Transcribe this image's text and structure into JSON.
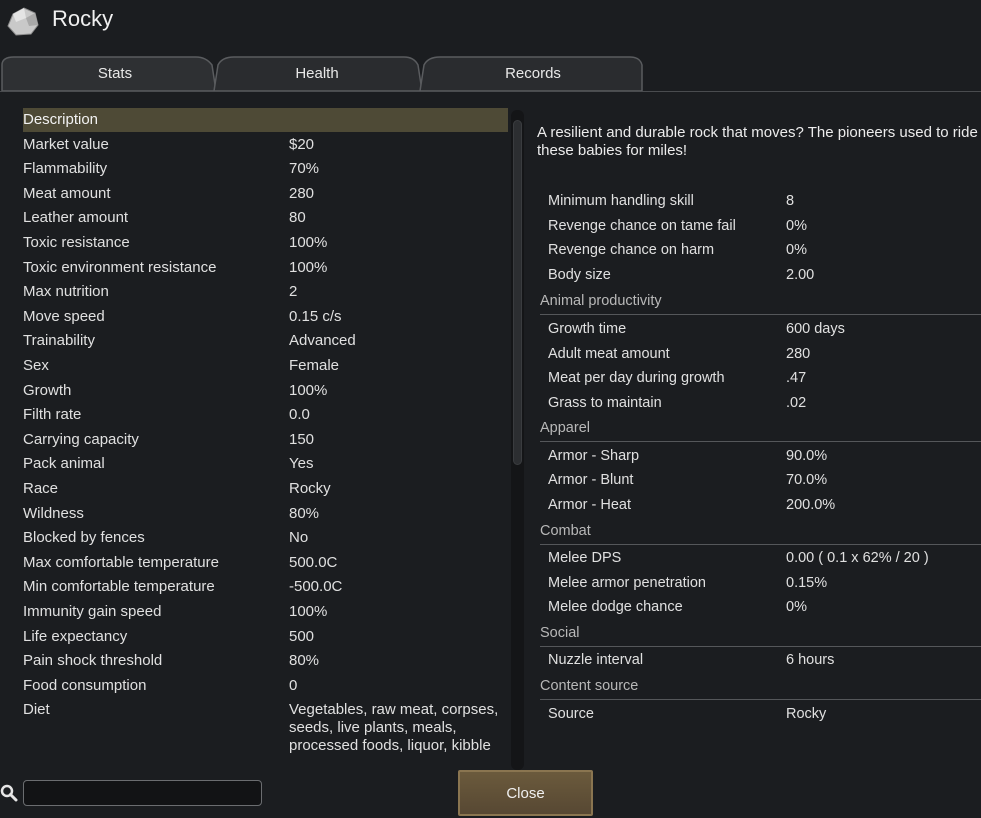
{
  "window": {
    "title": "Rocky"
  },
  "tabs": [
    {
      "label": "Stats"
    },
    {
      "label": "Health"
    },
    {
      "label": "Records"
    }
  ],
  "stats": [
    {
      "label": "Description",
      "value": ""
    },
    {
      "label": "Market value",
      "value": "$20"
    },
    {
      "label": "Flammability",
      "value": "70%"
    },
    {
      "label": "Meat amount",
      "value": "280"
    },
    {
      "label": "Leather amount",
      "value": "80"
    },
    {
      "label": "Toxic resistance",
      "value": "100%"
    },
    {
      "label": "Toxic environment resistance",
      "value": "100%"
    },
    {
      "label": "Max nutrition",
      "value": "2"
    },
    {
      "label": "Move speed",
      "value": "0.15 c/s"
    },
    {
      "label": "Trainability",
      "value": "Advanced"
    },
    {
      "label": "Sex",
      "value": "Female"
    },
    {
      "label": "Growth",
      "value": "100%"
    },
    {
      "label": "Filth rate",
      "value": "0.0"
    },
    {
      "label": "Carrying capacity",
      "value": "150"
    },
    {
      "label": "Pack animal",
      "value": "Yes"
    },
    {
      "label": "Race",
      "value": "Rocky"
    },
    {
      "label": "Wildness",
      "value": "80%"
    },
    {
      "label": "Blocked by fences",
      "value": "No"
    },
    {
      "label": "Max comfortable temperature",
      "value": "500.0C"
    },
    {
      "label": "Min comfortable temperature",
      "value": "-500.0C"
    },
    {
      "label": "Immunity gain speed",
      "value": "100%"
    },
    {
      "label": "Life expectancy",
      "value": "500"
    },
    {
      "label": "Pain shock threshold",
      "value": "80%"
    },
    {
      "label": "Food consumption",
      "value": "0"
    },
    {
      "label": "Diet",
      "value": "Vegetables, raw meat, corpses, seeds, live plants, meals, processed foods, liquor, kibble"
    }
  ],
  "description": "A resilient and durable rock that moves? The pioneers used to ride these babies for miles!",
  "details": {
    "general": [
      {
        "label": "Minimum handling skill",
        "value": "8"
      },
      {
        "label": "Revenge chance on tame fail",
        "value": "0%"
      },
      {
        "label": "Revenge chance on harm",
        "value": "0%"
      },
      {
        "label": "Body size",
        "value": "2.00"
      }
    ],
    "animal_productivity": {
      "heading": "Animal productivity",
      "rows": [
        {
          "label": "Growth time",
          "value": "600 days"
        },
        {
          "label": "Adult meat amount",
          "value": "280"
        },
        {
          "label": "Meat per day during growth",
          "value": ".47"
        },
        {
          "label": "Grass to maintain",
          "value": ".02"
        }
      ]
    },
    "apparel": {
      "heading": "Apparel",
      "rows": [
        {
          "label": "Armor - Sharp",
          "value": "90.0%"
        },
        {
          "label": "Armor - Blunt",
          "value": "70.0%"
        },
        {
          "label": "Armor - Heat",
          "value": "200.0%"
        }
      ]
    },
    "combat": {
      "heading": "Combat",
      "rows": [
        {
          "label": "Melee DPS",
          "value": "0.00 ( 0.1 x 62% / 20 )"
        },
        {
          "label": "Melee armor penetration",
          "value": "0.15%"
        },
        {
          "label": "Melee dodge chance",
          "value": "0%"
        }
      ]
    },
    "social": {
      "heading": "Social",
      "rows": [
        {
          "label": "Nuzzle interval",
          "value": "6 hours"
        }
      ]
    },
    "content_source": {
      "heading": "Content source",
      "rows": [
        {
          "label": "Source",
          "value": "Rocky"
        }
      ]
    }
  },
  "search": {
    "value": "",
    "icon": "search-icon"
  },
  "buttons": {
    "close_label": "Close"
  },
  "colors": {
    "background": "#1b1d20",
    "selected_row": "#4e4a36",
    "close_button": "#6b5a3c"
  }
}
